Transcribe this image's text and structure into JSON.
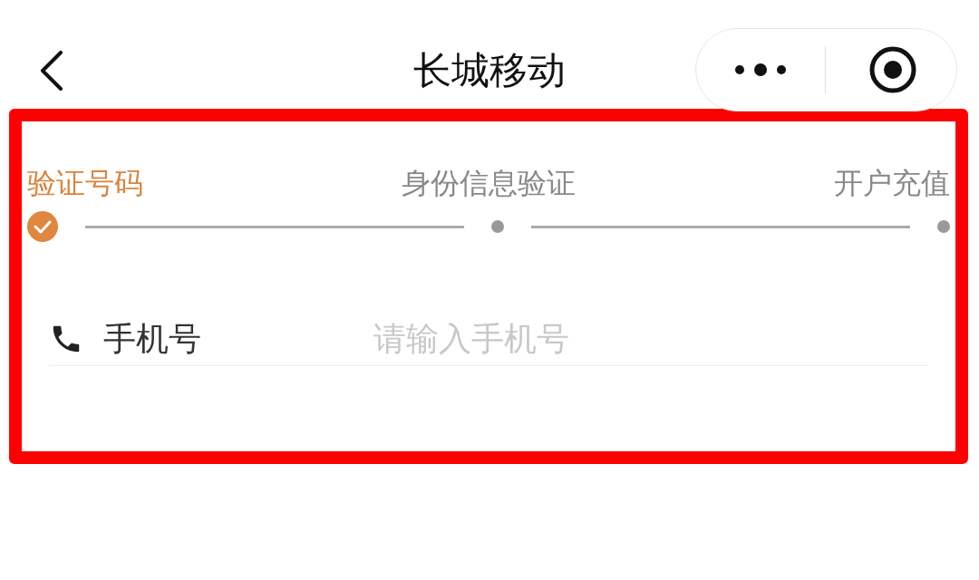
{
  "nav_bar": {
    "title": "长城移动"
  },
  "steps": [
    {
      "label": "验证号码",
      "completed": true
    },
    {
      "label": "身份信息验证",
      "completed": false
    },
    {
      "label": "开户充值",
      "completed": false
    }
  ],
  "phone_field": {
    "label": "手机号",
    "placeholder": "请输入手机号"
  }
}
